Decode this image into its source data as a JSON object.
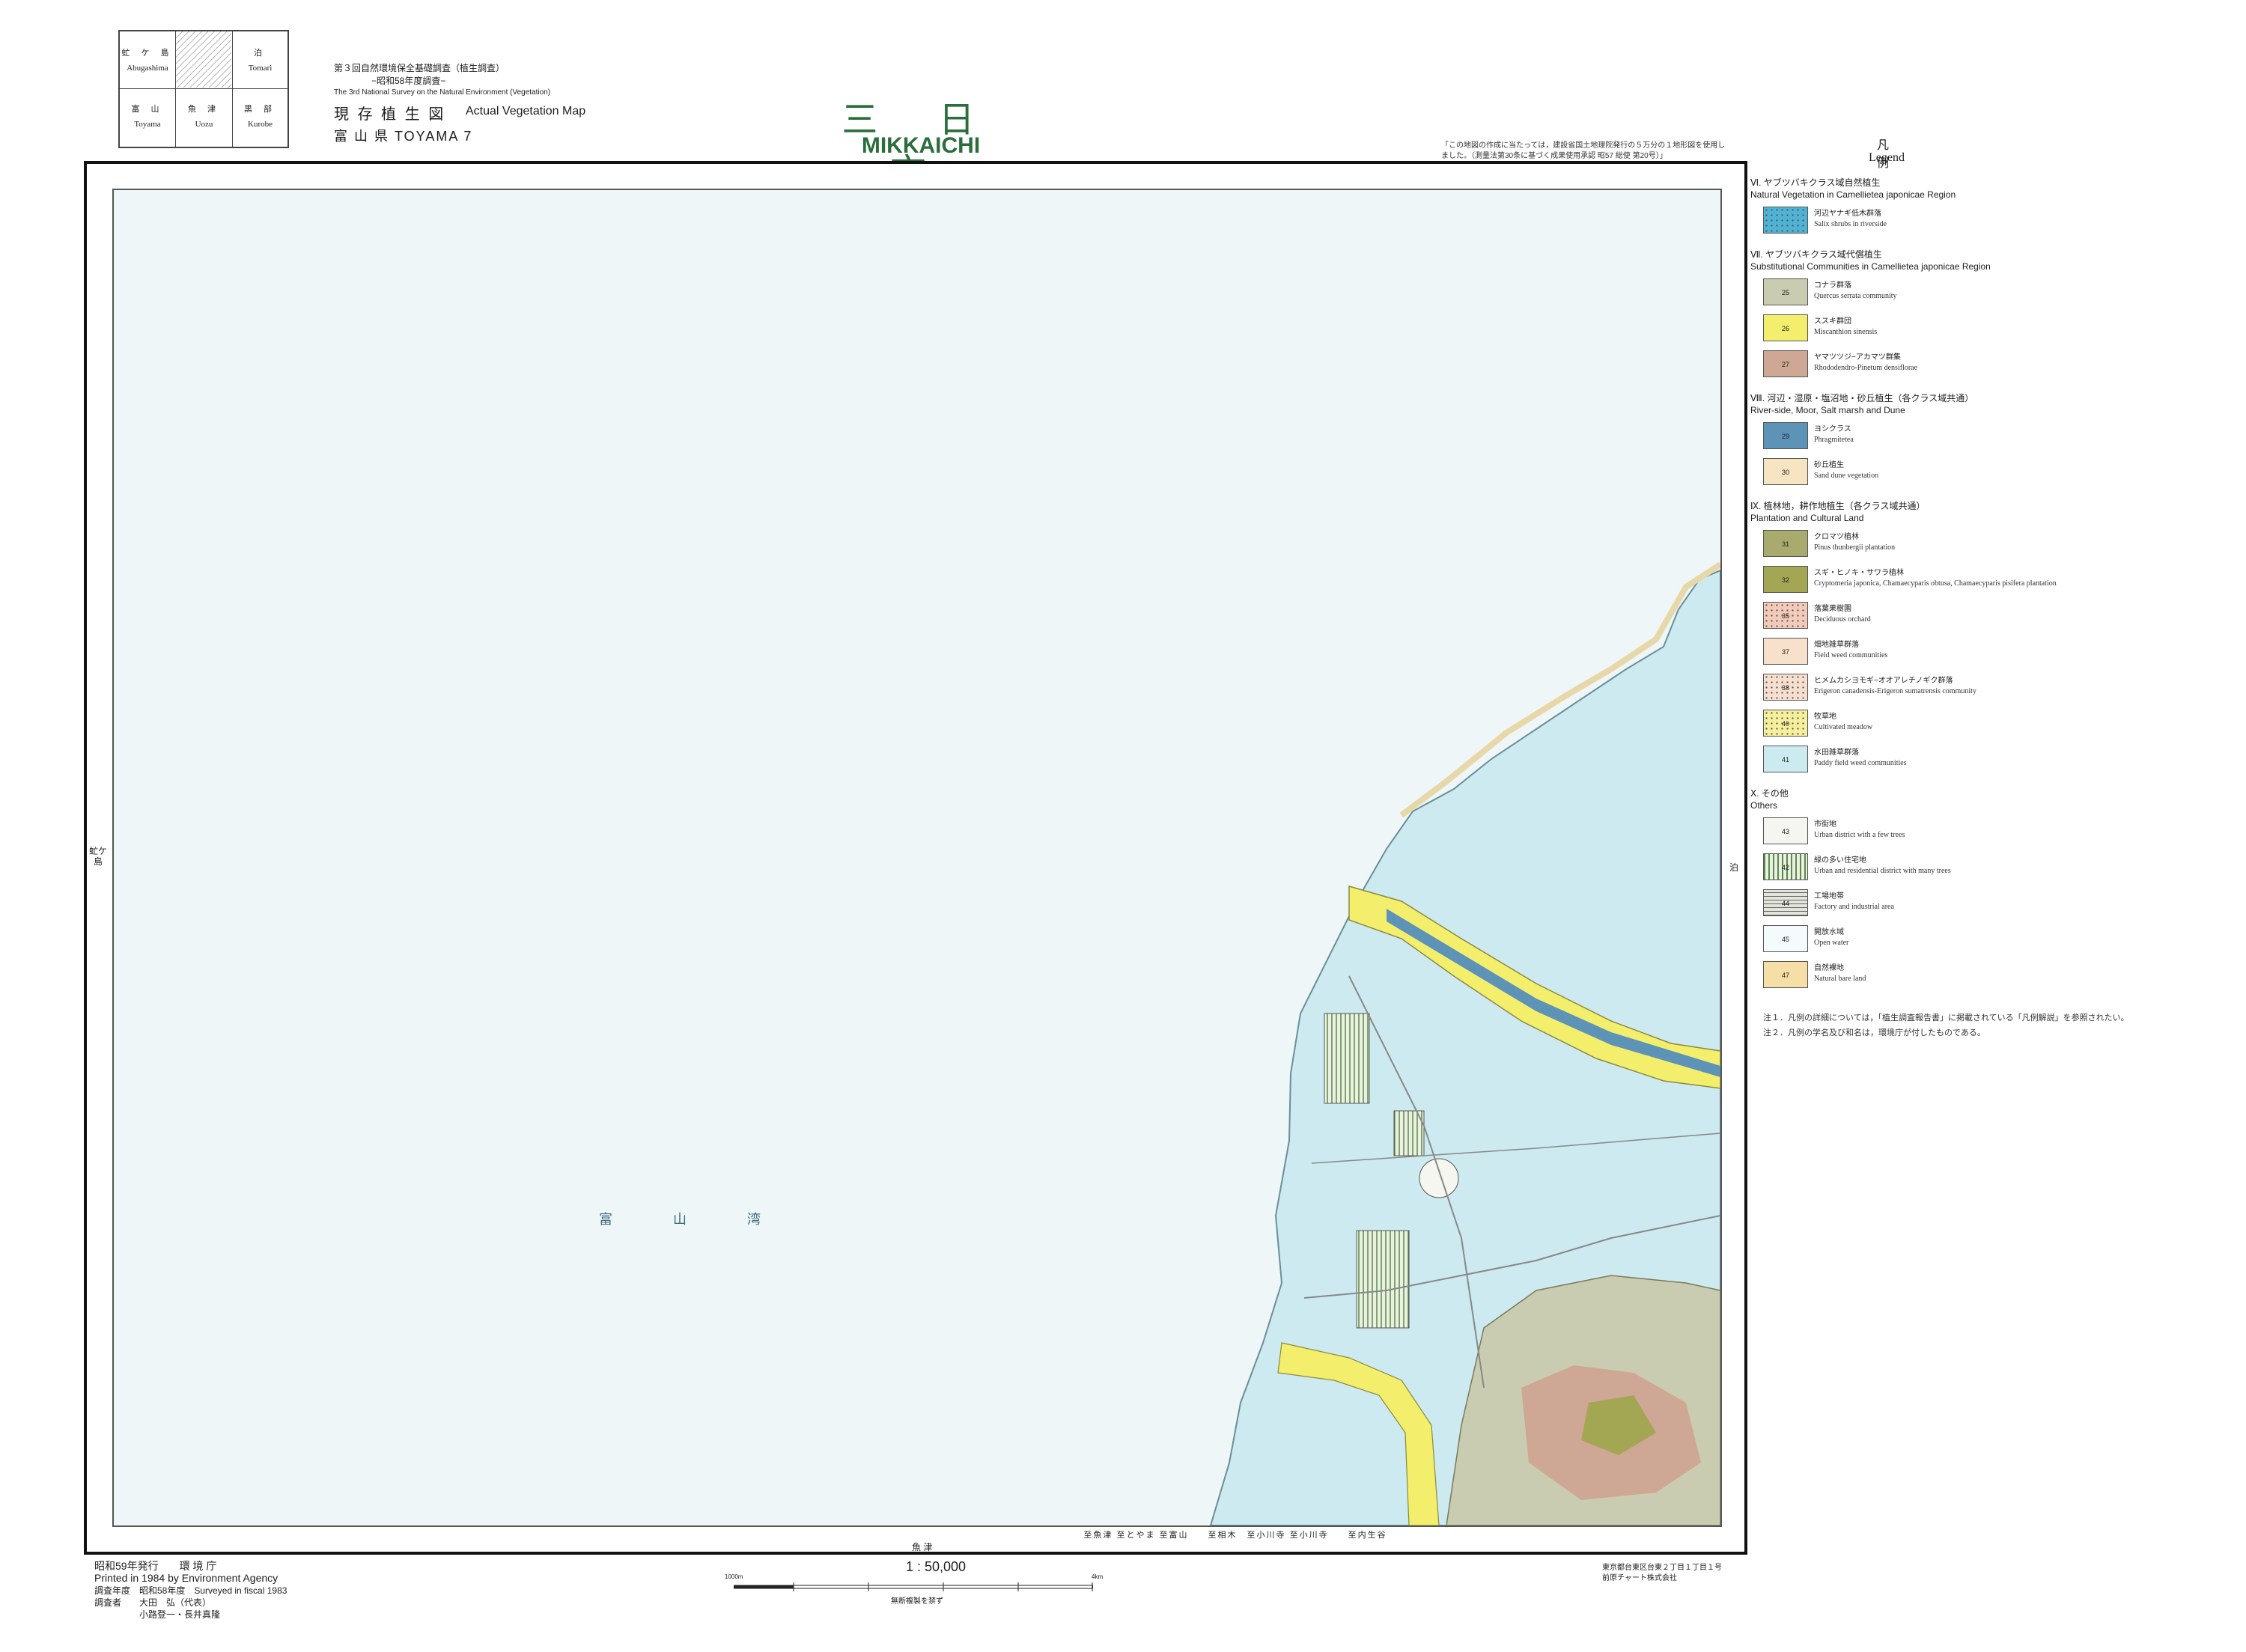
{
  "index_map": {
    "cells": [
      {
        "jp": "虻 ケ 島",
        "en": "Abugashima"
      },
      {
        "jp": "",
        "en": ""
      },
      {
        "jp": "泊",
        "en": "Tomari"
      },
      {
        "jp": "富 山",
        "en": "Toyama"
      },
      {
        "jp": "魚 津",
        "en": "Uozu"
      },
      {
        "jp": "黒 部",
        "en": "Kurobe"
      }
    ]
  },
  "header": {
    "survey_jp": "第３回自然環境保全基礎調査（植生調査）",
    "survey_year_jp": "−昭和58年度調査−",
    "survey_en": "The 3rd National Survey on the Natural Environment (Vegetation)",
    "map_type_jp": "現 存 植 生 図",
    "map_type_en": "Actual Vegetation Map",
    "prefecture": "富 山 県 TOYAMA 7",
    "title_jp": "三 日 市",
    "title_en": "MIKKAICHI",
    "credit_note": "「この地図の作成に当たっては，建設省国土地理院発行の５万分の１地形図を使用しました。（測量法第30条に基づく成果使用承認 昭57 総使 第20号）」"
  },
  "map": {
    "sea_label": "富 山 湾",
    "left_edge": "虻ケ島",
    "right_edge": "泊",
    "bottom_edge": "魚 津",
    "bottom_routes": "至魚津 至とやま 至富山　　至相木　至小川寺 至小川寺　　至内生谷"
  },
  "legend": {
    "title_jp": "凡　例",
    "title_en": "Legend",
    "sections": [
      {
        "heading_jp": "Ⅵ. ヤブツバキクラス域自然植生",
        "heading_en": "Natural Vegetation in Camellietea japonicae Region",
        "items": [
          {
            "code": "",
            "jp": "河辺ヤナギ低木群落",
            "en": "Salix shrubs in riverside",
            "color": "#4fb3d6",
            "pattern": "dots"
          }
        ]
      },
      {
        "heading_jp": "Ⅶ. ヤブツバキクラス域代償植生",
        "heading_en": "Substitutional Communities in Camellietea japonicae Region",
        "items": [
          {
            "code": "25",
            "jp": "コナラ群落",
            "en": "Quercus serrata community",
            "color": "#c9ccb0",
            "pattern": "none"
          },
          {
            "code": "26",
            "jp": "ススキ群団",
            "en": "Miscanthion sinensis",
            "color": "#f3ee6c",
            "pattern": "none"
          },
          {
            "code": "27",
            "jp": "ヤマツツジ−アカマツ群集",
            "en": "Rhododendro-Pinetum densiflorae",
            "color": "#cfa795",
            "pattern": "none"
          }
        ]
      },
      {
        "heading_jp": "Ⅷ. 河辺・湿原・塩沼地・砂丘植生（各クラス域共通）",
        "heading_en": "River-side, Moor, Salt marsh and Dune",
        "items": [
          {
            "code": "29",
            "jp": "ヨシクラス",
            "en": "Phragmitetea",
            "color": "#5e93b8",
            "pattern": "none"
          },
          {
            "code": "30",
            "jp": "砂丘植生",
            "en": "Sand dune vegetation",
            "color": "#f6e4c3",
            "pattern": "none"
          }
        ]
      },
      {
        "heading_jp": "Ⅸ. 植林地，耕作地植生（各クラス域共通）",
        "heading_en": "Plantation and Cultural Land",
        "items": [
          {
            "code": "31",
            "jp": "クロマツ植林",
            "en": "Pinus thunbergii plantation",
            "color": "#a9ab6e",
            "pattern": "none"
          },
          {
            "code": "32",
            "jp": "スギ・ヒノキ・サワラ植林",
            "en": "Cryptomeria japonica, Chamaecyparis obtusa, Chamaecyparis pisifera plantation",
            "color": "#a3a652",
            "pattern": "none"
          },
          {
            "code": "35",
            "jp": "落葉果樹園",
            "en": "Deciduous orchard",
            "color": "#f3cbbb",
            "pattern": "dots"
          },
          {
            "code": "37",
            "jp": "畑地雑草群落",
            "en": "Field weed communities",
            "color": "#f7e0cc",
            "pattern": "none"
          },
          {
            "code": "38",
            "jp": "ヒメムカシヨモギ−オオアレチノギク群落",
            "en": "Erigeron canadensis-Erigeron sumatrensis community",
            "color": "#f7dfd0",
            "pattern": "dots"
          },
          {
            "code": "40",
            "jp": "牧草地",
            "en": "Cultivated meadow",
            "color": "#f6ef9c",
            "pattern": "dots"
          },
          {
            "code": "41",
            "jp": "水田雑草群落",
            "en": "Paddy field weed communities",
            "color": "#ccebf1",
            "pattern": "none"
          }
        ]
      },
      {
        "heading_jp": "Ⅹ. その他",
        "heading_en": "Others",
        "items": [
          {
            "code": "43",
            "jp": "市街地",
            "en": "Urban district with a few trees",
            "color": "#f4f6ef",
            "pattern": "none"
          },
          {
            "code": "42",
            "jp": "緑の多い住宅地",
            "en": "Urban and residential district with many trees",
            "color": "#ebf0e2",
            "pattern": "vstripes"
          },
          {
            "code": "44",
            "jp": "工場地帯",
            "en": "Factory and industrial area",
            "color": "#e3e5dc",
            "pattern": "hstripes"
          },
          {
            "code": "45",
            "jp": "開放水域",
            "en": "Open water",
            "color": "#f5fbfd",
            "pattern": "none"
          },
          {
            "code": "47",
            "jp": "自然裸地",
            "en": "Natural bare land",
            "color": "#f6dfa6",
            "pattern": "none"
          }
        ]
      }
    ],
    "notes": [
      "注１．凡例の詳細については，「植生調査報告書」に掲載されている「凡例解説」を参照されたい。",
      "注２．凡例の学名及び和名は，環境庁が付したものである。"
    ]
  },
  "footer": {
    "issued_jp": "昭和59年発行　　環 境 庁",
    "printed_en": "Printed in 1984 by Environment Agency",
    "surveyed": "調査年度　昭和58年度　Surveyed in fiscal 1983",
    "surveyor_1": "調査者　　大田　弘（代表）",
    "surveyor_2": "　　　　　小路登一・長井真隆",
    "scale": "1 : 50,000",
    "scale_left_label": "1000m",
    "scale_right_label": "4km",
    "scale_caption": "無断複製を禁ず",
    "printer_1": "東京都台東区台東２丁目１丁目１号",
    "printer_2": "前原チャート株式会社"
  }
}
